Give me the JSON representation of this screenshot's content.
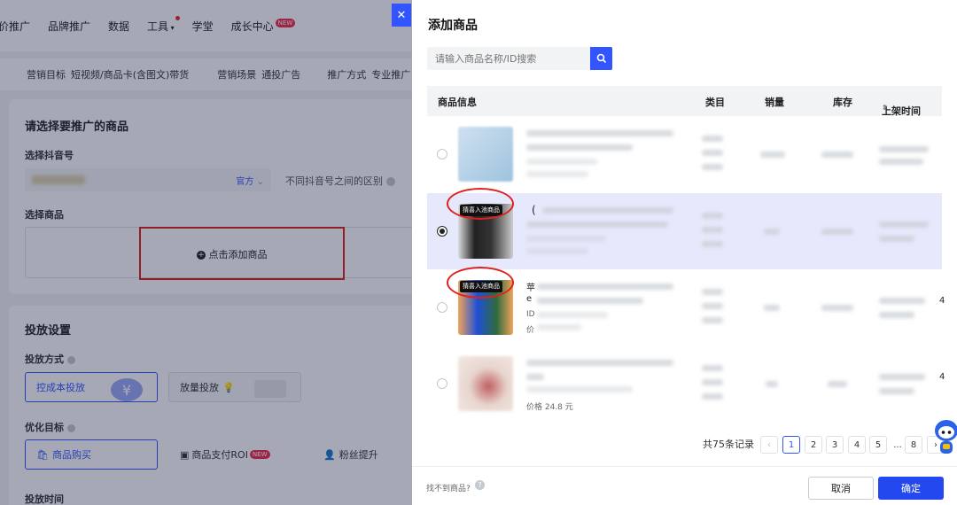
{
  "topnav": {
    "items": [
      "竞价推广",
      "品牌推广",
      "数据",
      "工具",
      "学堂",
      "成长中心"
    ],
    "new_badge": "NEW"
  },
  "subnav": {
    "goal_label": "营销目标",
    "goal_value": "短视频/商品卡(含图文)带货",
    "scene_label": "营销场景",
    "scene_value": "通投广告",
    "method_label": "推广方式",
    "method_value": "专业推广"
  },
  "left": {
    "section_title": "请选择要推广的商品",
    "account_label": "选择抖音号",
    "account_official": "官方",
    "account_diff": "不同抖音号之间的区别",
    "product_label": "选择商品",
    "add_product": "点击添加商品",
    "settings_title": "投放设置",
    "method_label": "投放方式",
    "method_options": [
      "控成本投放",
      "放量投放"
    ],
    "goal_label": "优化目标",
    "goal_options": [
      "商品购买",
      "商品支付ROI",
      "粉丝提升"
    ],
    "time_label": "投放时间"
  },
  "modal": {
    "title": "添加商品",
    "search_placeholder": "请输入商品名称/ID搜索",
    "columns": [
      "商品信息",
      "类目",
      "销量",
      "库存",
      "上架时间"
    ],
    "tag_text": "猜喜入池商品",
    "row_fragments": {
      "row2_char": "(",
      "row3_chars": [
        "苹",
        "e",
        "ID",
        "价"
      ],
      "row3_right": "4",
      "row4_price": "价格 24.8 元",
      "row4_right": "4"
    },
    "total": "共75条记录",
    "pages": [
      "1",
      "2",
      "3",
      "4",
      "5",
      "...",
      "8"
    ],
    "current_page": "1",
    "help_text": "找不到商品?",
    "cancel": "取消",
    "confirm": "确定"
  },
  "colors": {
    "primary": "#3355ff",
    "highlight_red": "#e0201c",
    "selected_row": "#e6e9fc"
  }
}
